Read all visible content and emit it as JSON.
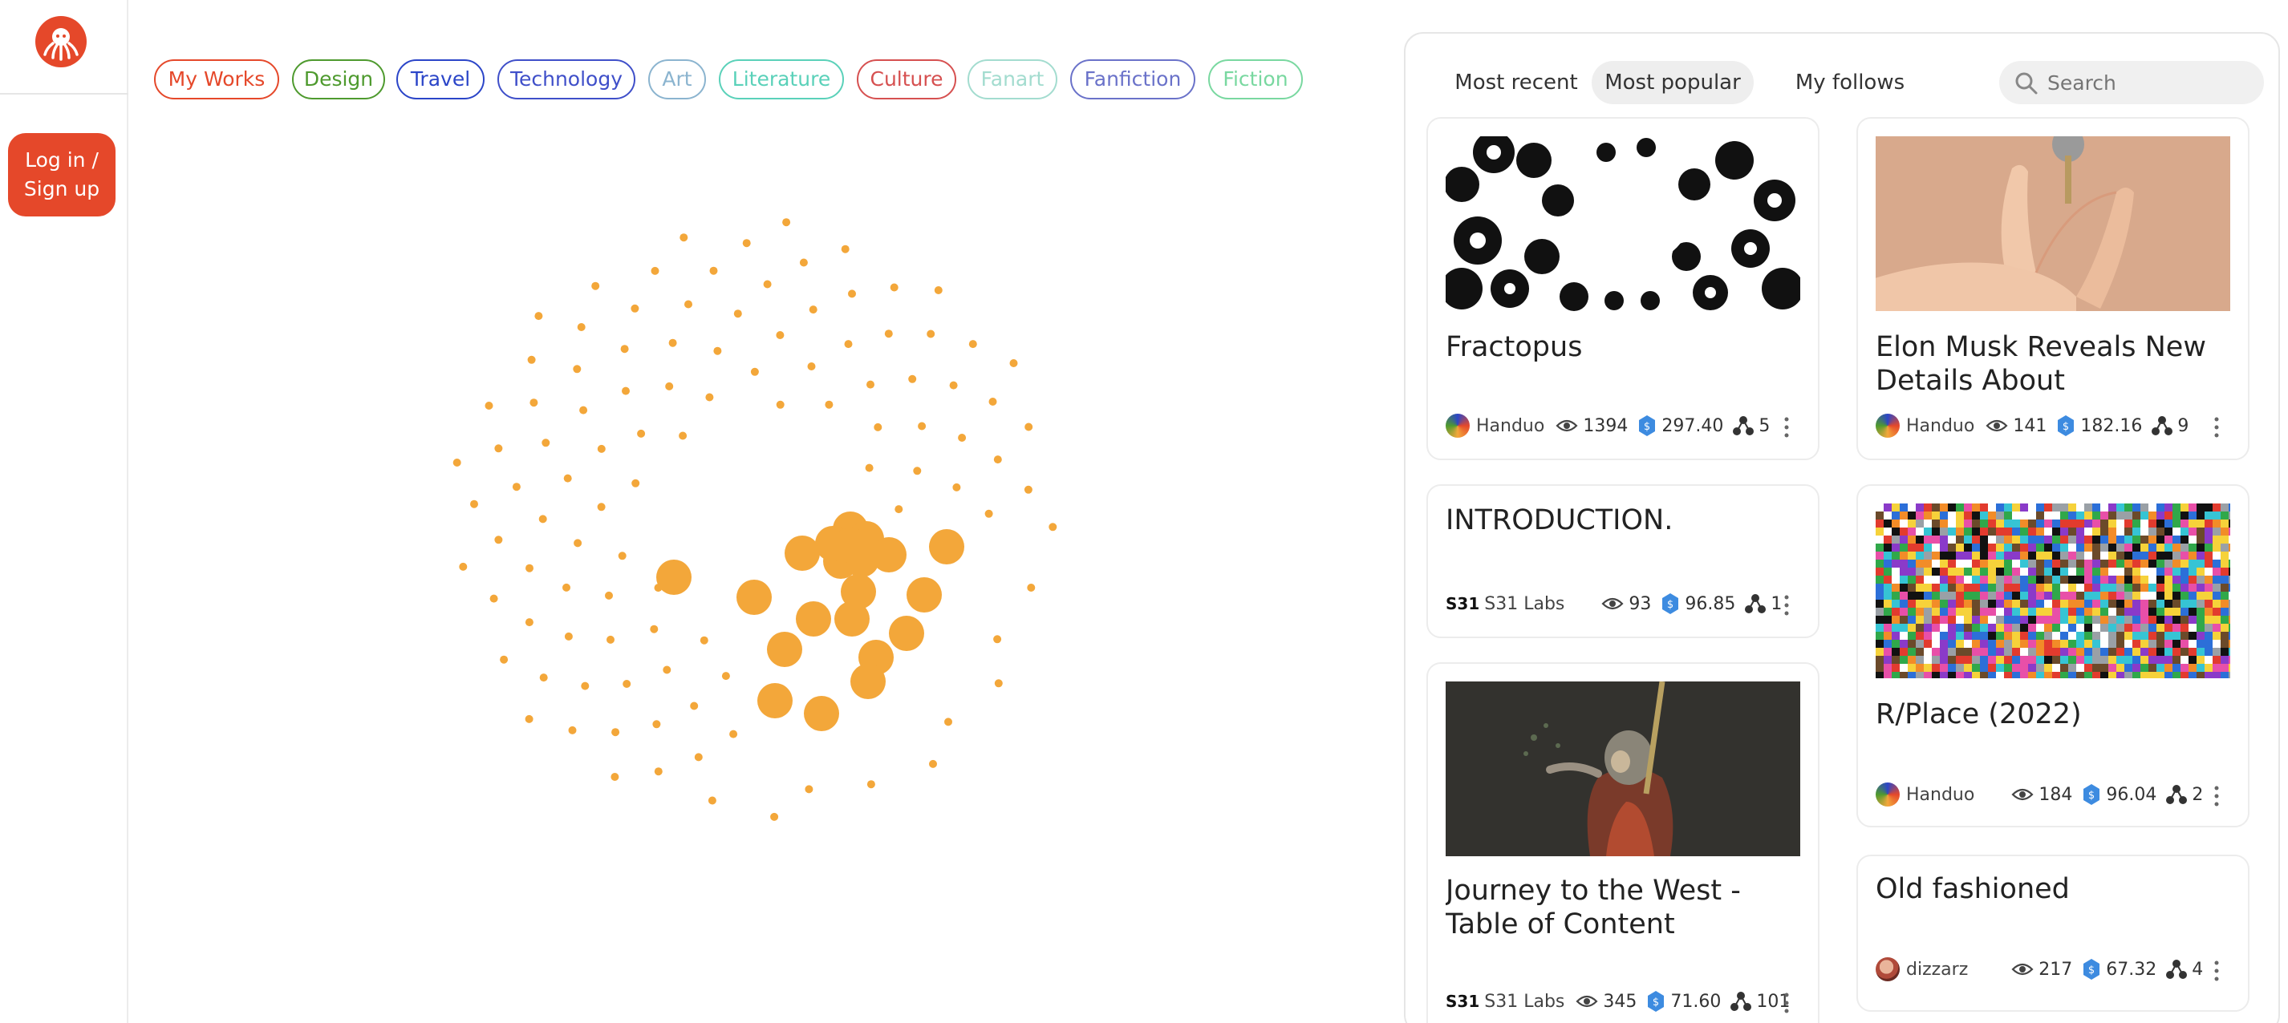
{
  "auth": {
    "login_label_line1": "Log in /",
    "login_label_line2": "Sign up"
  },
  "categories": [
    {
      "label": "My Works",
      "color": "#e5482a"
    },
    {
      "label": "Design",
      "color": "#4e9a2e"
    },
    {
      "label": "Travel",
      "color": "#2b45c8"
    },
    {
      "label": "Technology",
      "color": "#3f4fc9"
    },
    {
      "label": "Art",
      "color": "#8bb4cf"
    },
    {
      "label": "Literature",
      "color": "#5ad1b9"
    },
    {
      "label": "Culture",
      "color": "#d65050"
    },
    {
      "label": "Fanart",
      "color": "#a3dccf"
    },
    {
      "label": "Fanfiction",
      "color": "#6a72c9"
    },
    {
      "label": "Fiction",
      "color": "#79d8a0"
    }
  ],
  "dot_color": "#f3a73a",
  "feed": {
    "tabs": [
      "Most recent",
      "Most popular",
      "My follows"
    ],
    "active_tab": "Most popular",
    "search_placeholder": "Search",
    "cards": [
      {
        "title": "Fractopus",
        "author": "Handuo",
        "views": "1394",
        "value": "297.40",
        "shares": "5",
        "thumb": "fractal-image"
      },
      {
        "title": "Elon Musk Reveals New Details About Neuralink,...",
        "author": "Handuo",
        "views": "141",
        "value": "182.16",
        "shares": "9",
        "thumb": "hand-image"
      },
      {
        "title": "INTRODUCTION.",
        "author": "S31 Labs",
        "author_badge": "S31",
        "views": "93",
        "value": "96.85",
        "shares": "1"
      },
      {
        "title": "R/Place (2022)",
        "author": "Handuo",
        "views": "184",
        "value": "96.04",
        "shares": "2",
        "thumb": "pixel-mosaic-image"
      },
      {
        "title": "Journey to the West - Table of Content",
        "author": "S31 Labs",
        "author_badge": "S31",
        "views": "345",
        "value": "71.60",
        "shares": "101",
        "thumb": "monkey-king-painting"
      },
      {
        "title": "Old fashioned",
        "author": "dizzarz",
        "views": "217",
        "value": "67.32",
        "shares": "4"
      }
    ]
  }
}
